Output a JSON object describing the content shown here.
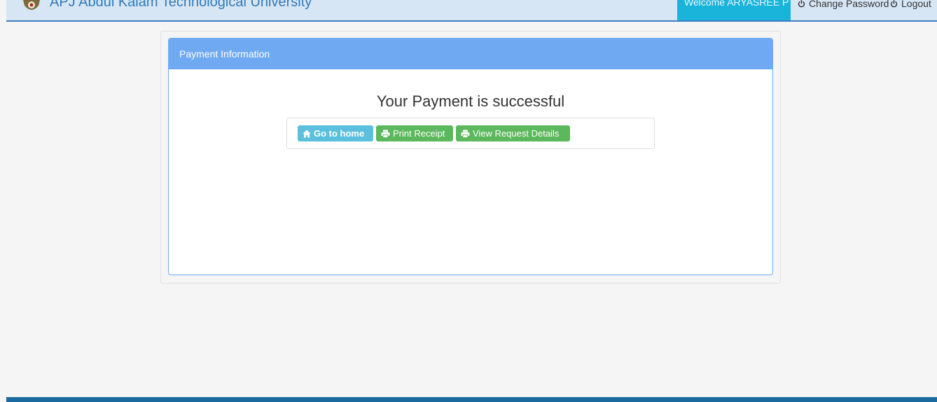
{
  "header": {
    "university_name": "APJ Abdul Kalam Technological University",
    "welcome_text": "Welcome ARYASREE P R",
    "change_password_label": "Change Password",
    "logout_label": "Logout"
  },
  "panel": {
    "heading": "Payment Information",
    "message": "Your Payment is successful"
  },
  "actions": {
    "home_label": "Go to home",
    "print_label": "Print Receipt",
    "view_label": "View Request Details"
  },
  "icons": {
    "home": "home-icon",
    "print": "print-icon",
    "view": "print-icon",
    "change_password": "power-icon",
    "logout": "power-icon"
  },
  "colors": {
    "header_bg": "#d6e6f5",
    "header_accent": "#3c7fc0",
    "welcome_bg": "#1ab3da",
    "panel_heading_bg": "#6fa9f2",
    "info_button": "#5bc0de",
    "success_button": "#5cb85c",
    "footer": "#1a6aa0"
  }
}
